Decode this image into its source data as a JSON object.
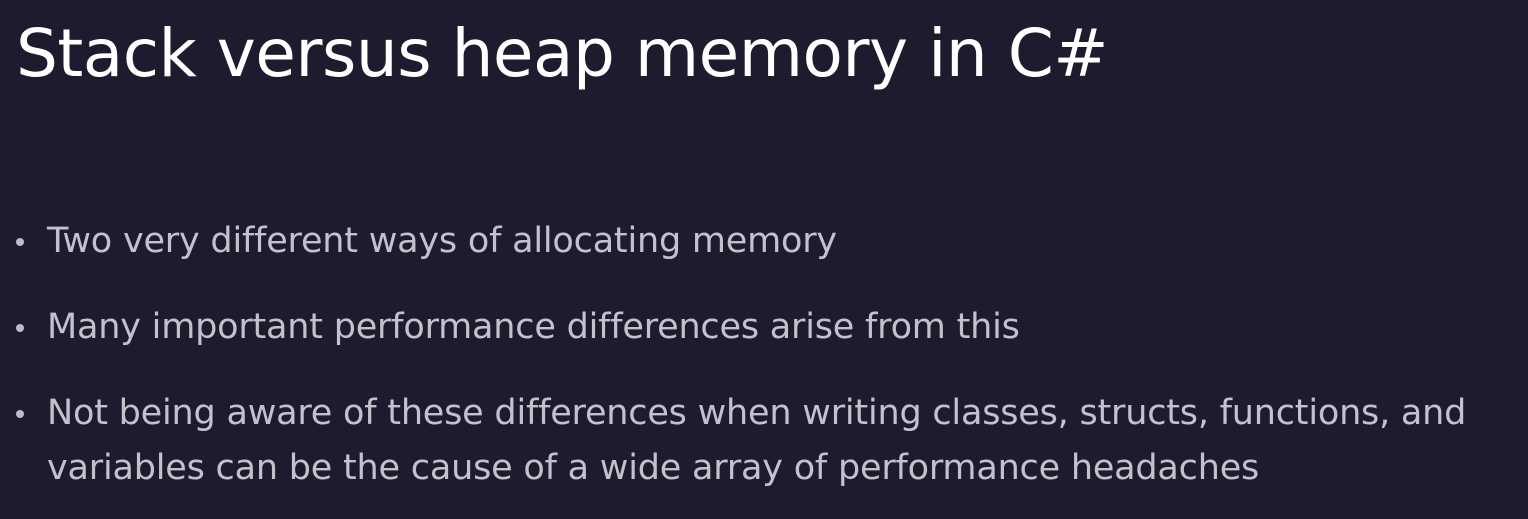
{
  "slide": {
    "title": "Stack versus heap memory in C#",
    "bullets": [
      {
        "text": "Two very different ways of allocating memory"
      },
      {
        "text": "Many important performance differences arise from this"
      },
      {
        "text": "Not being aware of these differences when writing classes, structs, functions, and variables can be the cause of a wide array of performance headaches"
      }
    ]
  },
  "colors": {
    "background": "#1c1c2e",
    "title": "#ffffff",
    "body_text": "#c2c2cc"
  }
}
